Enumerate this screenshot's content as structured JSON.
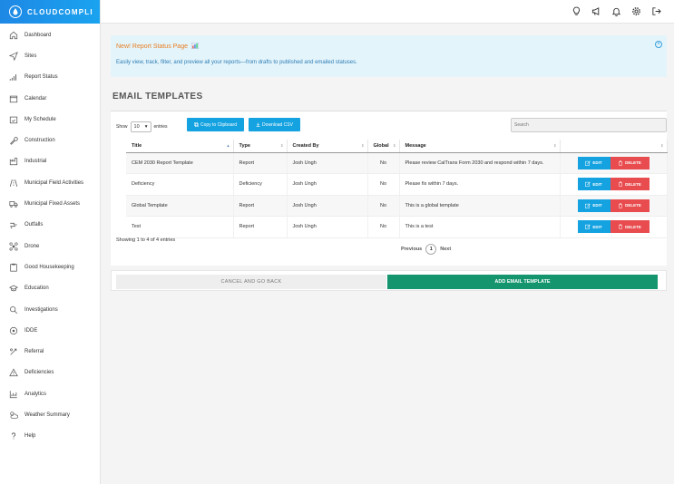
{
  "brand": {
    "name": "CLOUDCOMPLI",
    "color": "#1e88e5"
  },
  "sidebar": {
    "items": [
      {
        "label": "Dashboard",
        "icon": "home-icon"
      },
      {
        "label": "Sites",
        "icon": "paper-plane-icon"
      },
      {
        "label": "Report Status",
        "icon": "bar-signal-icon"
      },
      {
        "label": "Calendar",
        "icon": "calendar-icon"
      },
      {
        "label": "My Schedule",
        "icon": "calendar-check-icon"
      },
      {
        "label": "Construction",
        "icon": "wrench-icon"
      },
      {
        "label": "Industrial",
        "icon": "factory-icon"
      },
      {
        "label": "Municipal Field Activities",
        "icon": "road-icon"
      },
      {
        "label": "Municipal Fixed Assets",
        "icon": "truck-icon"
      },
      {
        "label": "Outfalls",
        "icon": "pipe-icon"
      },
      {
        "label": "Drone",
        "icon": "drone-icon"
      },
      {
        "label": "Good Housekeeping",
        "icon": "clipboard-icon"
      },
      {
        "label": "Education",
        "icon": "graduation-cap-icon"
      },
      {
        "label": "Investigations",
        "icon": "magnifier-icon"
      },
      {
        "label": "IDDE",
        "icon": "target-icon"
      },
      {
        "label": "Referral",
        "icon": "referral-icon"
      },
      {
        "label": "Deficiencies",
        "icon": "warning-icon"
      },
      {
        "label": "Analytics",
        "icon": "chart-icon"
      },
      {
        "label": "Weather Summary",
        "icon": "cloud-sun-icon"
      },
      {
        "label": "Help",
        "icon": "help-icon"
      }
    ]
  },
  "topbar": {
    "icons": [
      "lightbulb-icon",
      "megaphone-icon",
      "bell-icon",
      "gear-icon",
      "logout-icon"
    ]
  },
  "alert": {
    "title": "New! Report Status Page",
    "body": "Easily view, track, filter, and preview all your reports—from drafts to published and emailed statuses.",
    "title_color": "#e67e22",
    "bg_color": "#e4f4fb"
  },
  "page": {
    "title": "EMAIL TEMPLATES"
  },
  "table_controls": {
    "show_label": "Show",
    "entries_value": "10",
    "entries_label": "entries",
    "copy_button": "Copy to Clipboard",
    "csv_button": "Download CSV",
    "search_placeholder": "Search"
  },
  "table": {
    "columns": [
      "Title",
      "Type",
      "Created By",
      "Global",
      "Message",
      ""
    ],
    "rows": [
      {
        "title": "CEM 2030 Report Template",
        "type": "Report",
        "created_by": "Josh Ungh",
        "global": "No",
        "message": "Please review CalTrans Form 2030 and respond within 7 days."
      },
      {
        "title": "Deficiency",
        "type": "Deficiency",
        "created_by": "Josh Ungh",
        "global": "No",
        "message": "Please fix within 7 days."
      },
      {
        "title": "Global Template",
        "type": "Report",
        "created_by": "Josh Ungh",
        "global": "No",
        "message": "This is a global template"
      },
      {
        "title": "Test",
        "type": "Report",
        "created_by": "Josh Ungh",
        "global": "No",
        "message": "This is a test"
      }
    ],
    "edit_label": "EDIT",
    "delete_label": "DELETE",
    "info": "Showing 1 to 4 of 4 entries",
    "pager": {
      "previous": "Previous",
      "current": "1",
      "next": "Next"
    }
  },
  "footer": {
    "cancel_label": "CANCEL AND GO BACK",
    "add_label": "ADD EMAIL TEMPLATE",
    "add_color": "#14956e"
  }
}
